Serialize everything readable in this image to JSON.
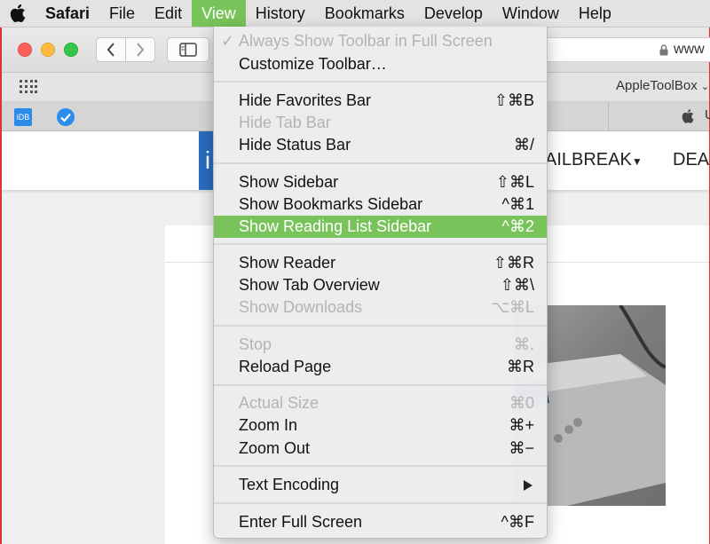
{
  "menubar": {
    "app_name": "Safari",
    "items": [
      "File",
      "Edit",
      "View",
      "History",
      "Bookmarks",
      "Develop",
      "Window",
      "Help"
    ],
    "active_item": "View"
  },
  "window": {
    "address_text": "www",
    "favorites_item": "AppleToolBox",
    "tab_icon_label": "iDB",
    "tab_partial_text": "U"
  },
  "page": {
    "logo_text": "i",
    "nav": [
      "AILBREAK",
      "DEAL"
    ]
  },
  "view_menu": {
    "items": [
      {
        "label": "Always Show Toolbar in Full Screen",
        "shortcut": "",
        "disabled": true,
        "checked": true
      },
      {
        "label": "Customize Toolbar…",
        "shortcut": "",
        "disabled": false
      },
      {
        "label": "Hide Favorites Bar",
        "shortcut": "⇧⌘B",
        "disabled": false
      },
      {
        "label": "Hide Tab Bar",
        "shortcut": "",
        "disabled": true
      },
      {
        "label": "Hide Status Bar",
        "shortcut": "⌘/",
        "disabled": false
      },
      {
        "label": "Show Sidebar",
        "shortcut": "⇧⌘L",
        "disabled": false
      },
      {
        "label": "Show Bookmarks Sidebar",
        "shortcut": "^⌘1",
        "disabled": false
      },
      {
        "label": "Show Reading List Sidebar",
        "shortcut": "^⌘2",
        "disabled": false,
        "highlighted": true
      },
      {
        "label": "Show Reader",
        "shortcut": "⇧⌘R",
        "disabled": false
      },
      {
        "label": "Show Tab Overview",
        "shortcut": "⇧⌘\\",
        "disabled": false
      },
      {
        "label": "Show Downloads",
        "shortcut": "⌥⌘L",
        "disabled": true
      },
      {
        "label": "Stop",
        "shortcut": "⌘.",
        "disabled": true
      },
      {
        "label": "Reload Page",
        "shortcut": "⌘R",
        "disabled": false
      },
      {
        "label": "Actual Size",
        "shortcut": "⌘0",
        "disabled": true
      },
      {
        "label": "Zoom In",
        "shortcut": "⌘+",
        "disabled": false
      },
      {
        "label": "Zoom Out",
        "shortcut": "⌘−",
        "disabled": false
      },
      {
        "label": "Text Encoding",
        "shortcut": "",
        "disabled": false,
        "submenu": true
      },
      {
        "label": "Enter Full Screen",
        "shortcut": "^⌘F",
        "disabled": false
      }
    ],
    "highlight_color": "#78c35a"
  },
  "icons": {
    "apple": "apple-logo-icon",
    "checkmark": "checkmark-icon",
    "lock": "lock-icon",
    "grid": "grid-icon"
  }
}
